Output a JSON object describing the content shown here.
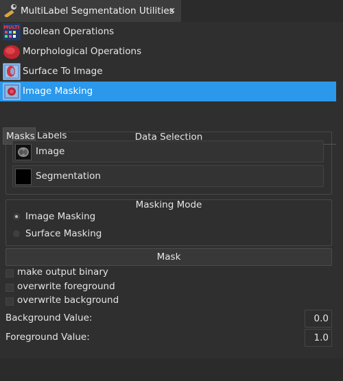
{
  "window": {
    "tab_title": "MultiLabel Segmentation Utilities",
    "close_glyph": "×"
  },
  "tools": [
    {
      "label": "Boolean Operations",
      "icon": "multilabel-boolean-icon",
      "selected": false
    },
    {
      "label": "Morphological Operations",
      "icon": "morphological-icon",
      "selected": false
    },
    {
      "label": "Surface To Image",
      "icon": "surface-to-image-icon",
      "selected": false
    },
    {
      "label": "Image Masking",
      "icon": "image-masking-icon",
      "selected": true
    }
  ],
  "subtabs": {
    "masks": "Masks",
    "labels": "Labels",
    "active": "Masks"
  },
  "data_selection": {
    "title": "Data Selection",
    "image_label": "Image",
    "segmentation_label": "Segmentation"
  },
  "masking_mode": {
    "title": "Masking Mode",
    "options": [
      {
        "label": "Image Masking",
        "checked": true
      },
      {
        "label": "Surface Masking",
        "checked": false
      }
    ]
  },
  "mask_button": "Mask",
  "options": [
    {
      "label": "make output binary",
      "checked": false
    },
    {
      "label": "overwrite foreground",
      "checked": false
    },
    {
      "label": "overwrite background",
      "checked": false
    }
  ],
  "fields": {
    "background_label": "Background Value:",
    "background_value": "0.0",
    "foreground_label": "Foreground Value:",
    "foreground_value": "1.0"
  },
  "colors": {
    "selection": "#2b98eb",
    "background": "#2f2f2f"
  }
}
